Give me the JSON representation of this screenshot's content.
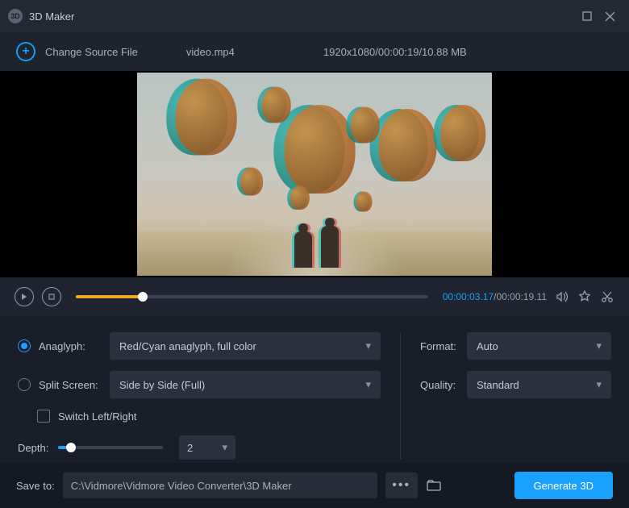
{
  "app": {
    "title": "3D Maker",
    "icon_label": "3D"
  },
  "source": {
    "change_label": "Change Source File",
    "filename": "video.mp4",
    "info": "1920x1080/00:00:19/10.88 MB"
  },
  "playback": {
    "current_time": "00:00:03.17",
    "total_time": "/00:00:19.11"
  },
  "settings": {
    "anaglyph": {
      "label": "Anaglyph:",
      "value": "Red/Cyan anaglyph, full color",
      "selected": true
    },
    "split_screen": {
      "label": "Split Screen:",
      "value": "Side by Side (Full)",
      "selected": false
    },
    "switch_lr": {
      "label": "Switch Left/Right",
      "checked": false
    },
    "depth": {
      "label": "Depth:",
      "value": "2"
    },
    "format": {
      "label": "Format:",
      "value": "Auto"
    },
    "quality": {
      "label": "Quality:",
      "value": "Standard"
    }
  },
  "footer": {
    "save_label": "Save to:",
    "path": "C:\\Vidmore\\Vidmore Video Converter\\3D Maker",
    "generate_label": "Generate 3D"
  }
}
